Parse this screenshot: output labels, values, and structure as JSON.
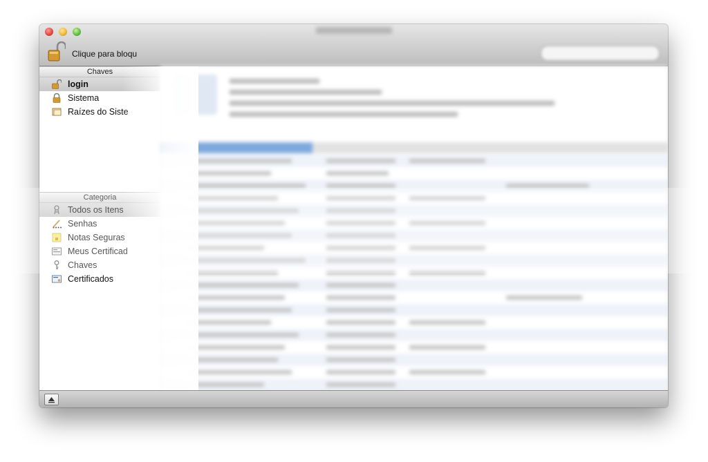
{
  "toolbar": {
    "lock_label": "Clique para bloqu"
  },
  "sidebar": {
    "keychains_header": "Chaves",
    "keychains": [
      {
        "label": "login",
        "icon": "unlocked-padlock-icon"
      },
      {
        "label": "Sistema",
        "icon": "locked-padlock-icon"
      },
      {
        "label": "Raízes do Siste",
        "icon": "folder-icon"
      }
    ],
    "category_header": "Categoria",
    "categories": [
      {
        "label": "Todos os Itens",
        "icon": "all-items-icon"
      },
      {
        "label": "Senhas",
        "icon": "passwords-icon"
      },
      {
        "label": "Notas Seguras",
        "icon": "secure-notes-icon"
      },
      {
        "label": "Meus Certificad",
        "icon": "my-certificates-icon"
      },
      {
        "label": "Chaves",
        "icon": "key-icon"
      },
      {
        "label": "Certificados",
        "icon": "certificate-icon"
      }
    ]
  },
  "colors": {
    "selection_gray": "#cfcfcf",
    "table_selection": "#7ea9dd"
  }
}
